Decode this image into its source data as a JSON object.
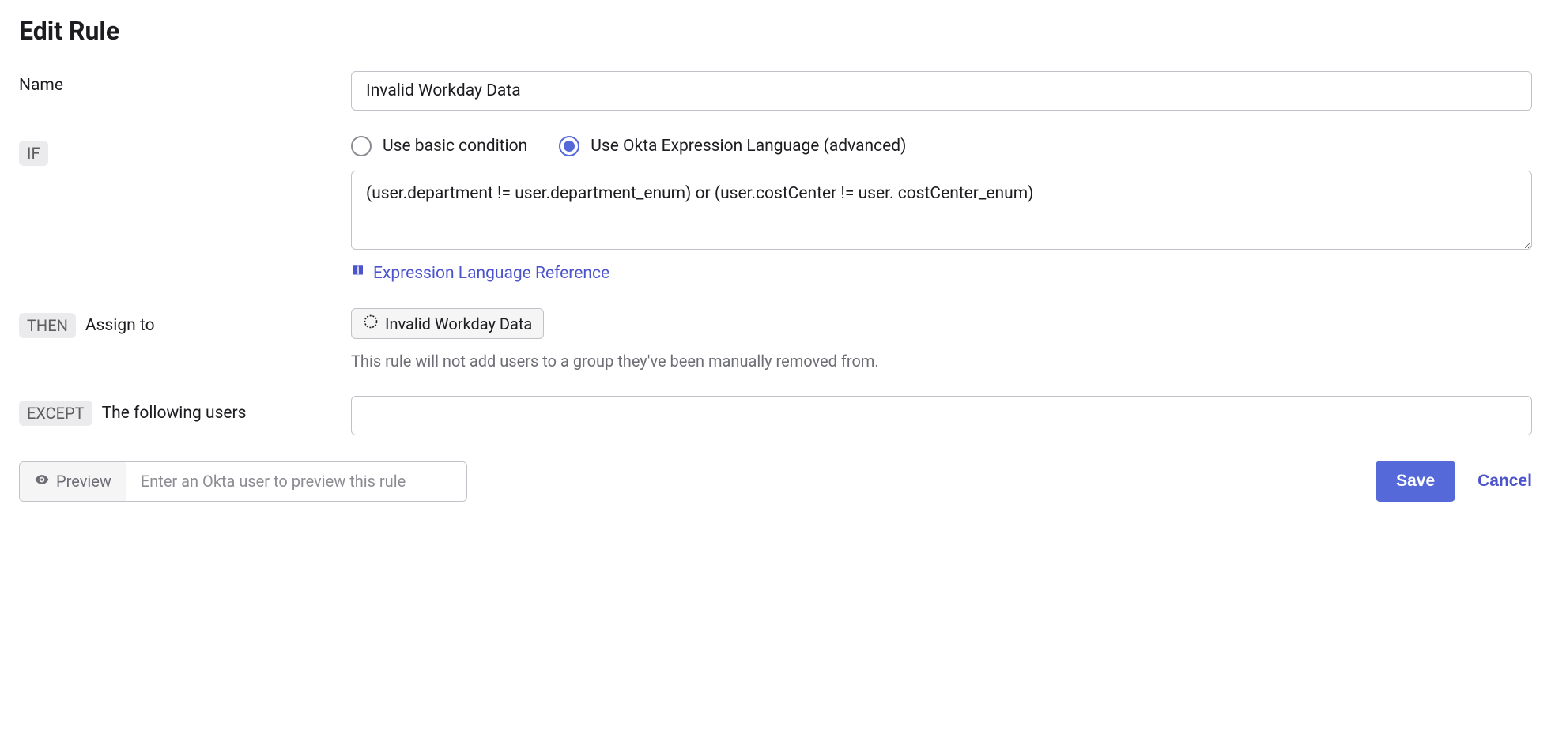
{
  "title": "Edit Rule",
  "name": {
    "label": "Name",
    "value": "Invalid Workday Data"
  },
  "if": {
    "badge": "IF",
    "options": {
      "basic": "Use basic condition",
      "advanced": "Use Okta Expression Language (advanced)"
    },
    "selected": "advanced",
    "expression": "(user.department != user.department_enum) or (user.costCenter != user. costCenter_enum)",
    "reference_link": "Expression Language Reference"
  },
  "then": {
    "badge": "THEN",
    "label": "Assign to",
    "group": "Invalid Workday Data",
    "help": "This rule will not add users to a group they've been manually removed from."
  },
  "except": {
    "badge": "EXCEPT",
    "label": "The following users",
    "value": ""
  },
  "preview": {
    "label": "Preview",
    "placeholder": "Enter an Okta user to preview this rule"
  },
  "actions": {
    "save": "Save",
    "cancel": "Cancel"
  }
}
